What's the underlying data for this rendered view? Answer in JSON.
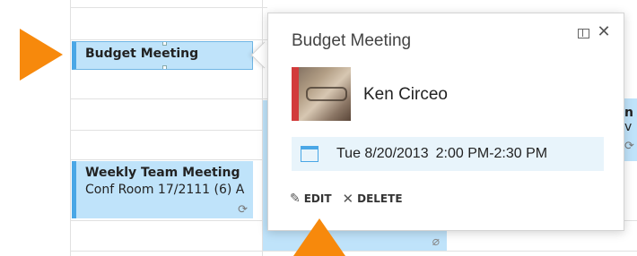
{
  "events": {
    "budget": {
      "title": "Budget Meeting"
    },
    "weekly": {
      "title": "Weekly Team Meeting",
      "location": "Conf Room 17/2111 (6) A"
    },
    "edge": {
      "line1": "n",
      "line2": "v"
    }
  },
  "popup": {
    "title": "Budget Meeting",
    "organizer": "Ken Circeo",
    "date": "Tue 8/20/2013",
    "time": "2:00 PM-2:30 PM",
    "actions": {
      "edit": "EDIT",
      "delete": "DELETE"
    },
    "icons": [
      "popout-icon",
      "close-icon",
      "calendar-icon",
      "pencil-icon",
      "delete-icon"
    ]
  },
  "colors": {
    "event_fill": "#bfe3fa",
    "event_accent": "#4aa7e6",
    "date_bar": "#e8f4fb",
    "callout_arrow": "#f7890c"
  }
}
